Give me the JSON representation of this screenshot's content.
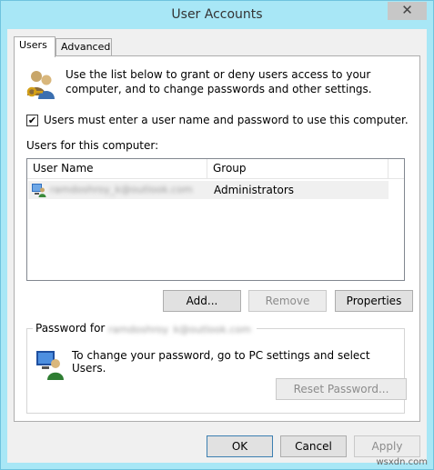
{
  "window": {
    "title": "User Accounts",
    "close_glyph": "✕"
  },
  "tabs": [
    {
      "label": "Users",
      "active": true
    },
    {
      "label": "Advanced",
      "active": false
    }
  ],
  "intro": {
    "icon": "users-keys-icon",
    "text": "Use the list below to grant or deny users access to your computer, and to change passwords and other settings."
  },
  "require_login": {
    "checked": true,
    "check_glyph": "✔",
    "label": "Users must enter a user name and password to use this computer."
  },
  "users_list": {
    "label": "Users for this computer:",
    "columns": [
      "User Name",
      "Group"
    ],
    "rows": [
      {
        "icon": "user-account-icon",
        "name": "ramdoshroy_k@outlook.com",
        "group": "Administrators"
      }
    ]
  },
  "list_buttons": {
    "add": "Add...",
    "remove": "Remove",
    "properties": "Properties"
  },
  "password_group": {
    "legend_prefix": "Password for",
    "user": "ramdoshroy_k@outlook.com",
    "icon": "password-user-icon",
    "text": "To change your password, go to PC settings and select Users.",
    "reset_button": "Reset Password..."
  },
  "dialog_buttons": {
    "ok": "OK",
    "cancel": "Cancel",
    "apply": "Apply"
  },
  "watermark": "wsxdn.com"
}
